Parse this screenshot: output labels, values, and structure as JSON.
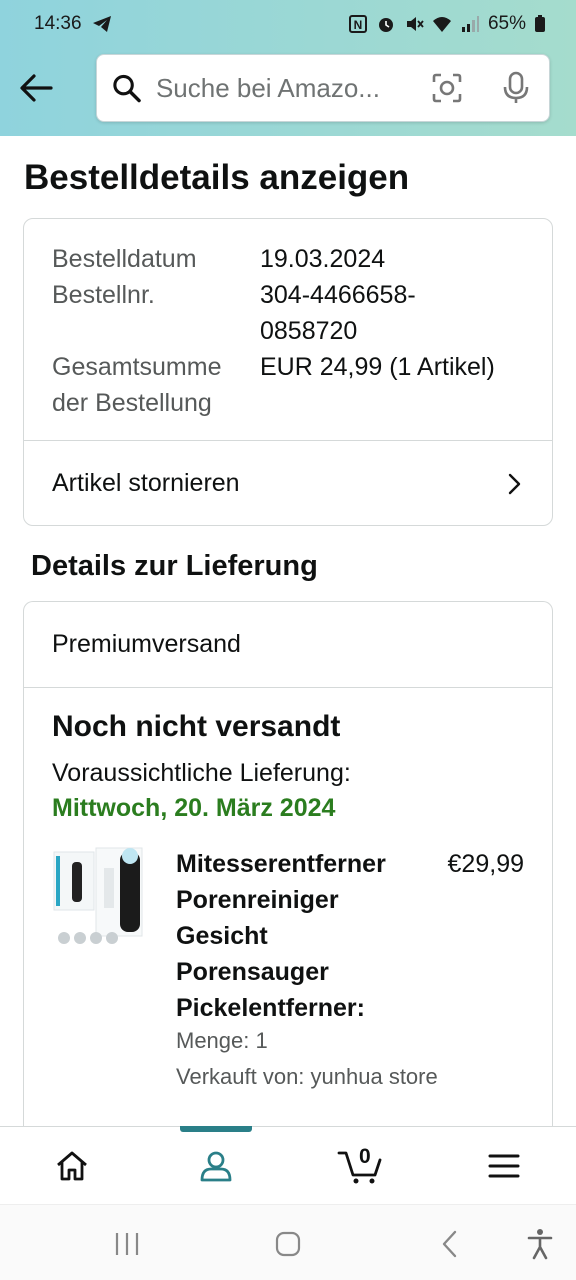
{
  "status_bar": {
    "time": "14:36",
    "battery": "65%",
    "icons": [
      "telegram-icon",
      "nfc-icon",
      "alarm-icon",
      "mute-icon",
      "wifi-icon",
      "signal-icon",
      "battery-icon"
    ]
  },
  "search": {
    "placeholder": "Suche bei Amazo..."
  },
  "page": {
    "title": "Bestelldetails anzeigen"
  },
  "order": {
    "date_label": "Bestelldatum",
    "date_value": "19.03.2024",
    "number_label": "Bestellnr.",
    "number_value_line1": "304-4466658-",
    "number_value_line2": "0858720",
    "total_label_line1": "Gesamtsumme",
    "total_label_line2": "der Bestellung",
    "total_value": "EUR 24,99 (1 Artikel)",
    "cancel_label": "Artikel stornieren"
  },
  "delivery": {
    "section_title": "Details zur Lieferung",
    "shipping_method": "Premiumversand",
    "status": "Noch nicht versandt",
    "expected_label": "Voraussichtliche Lieferung:",
    "expected_date": "Mittwoch, 20. März 2024",
    "expected_date_color": "#2b7d1f"
  },
  "product": {
    "name_lines": [
      "Mitesserentferner",
      "Porenreiniger",
      "Gesicht",
      "Porensauger",
      "Pickelentferner:"
    ],
    "price": "€29,99",
    "quantity": "Menge: 1",
    "seller": "Verkauft von: yunhua store"
  },
  "bottom_nav": {
    "items": [
      "home-icon",
      "account-icon",
      "cart-icon",
      "menu-icon"
    ],
    "active": "account-icon",
    "cart_count": "0",
    "accent": "#2a7f88"
  }
}
